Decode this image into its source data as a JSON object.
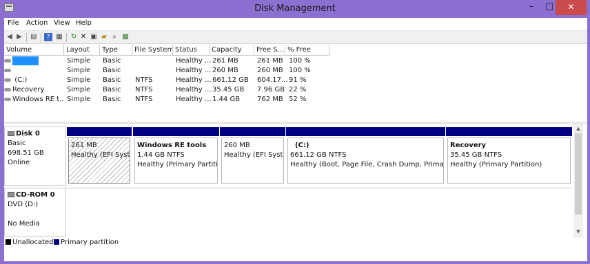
{
  "app": {
    "title": "Disk Management",
    "close_glyph": "✕",
    "minimize_glyph": "–",
    "maximize_glyph": "□"
  },
  "menu": [
    "File",
    "Action",
    "View",
    "Help"
  ],
  "toolbar_icons": [
    "back-arrow-icon",
    "forward-arrow-icon",
    "console-tree-icon",
    "help-icon",
    "details-icon",
    "refresh-icon",
    "delete-icon",
    "properties-icon",
    "open-icon",
    "find-icon",
    "wizard-icon"
  ],
  "table": {
    "columns": [
      "Volume",
      "Layout",
      "Type",
      "File System",
      "Status",
      "Capacity",
      "Free S...",
      "% Free"
    ],
    "rows": [
      {
        "volume": "",
        "layout": "Simple",
        "type": "Basic",
        "fs": "",
        "status": "Healthy ...",
        "capacity": "261 MB",
        "free": "261 MB",
        "pct": "100 %"
      },
      {
        "volume": "",
        "layout": "Simple",
        "type": "Basic",
        "fs": "",
        "status": "Healthy ...",
        "capacity": "260 MB",
        "free": "260 MB",
        "pct": "100 %"
      },
      {
        "volume": "(C:)",
        "layout": "Simple",
        "type": "Basic",
        "fs": "NTFS",
        "status": "Healthy ...",
        "capacity": "661.12 GB",
        "free": "604.17...",
        "pct": "91 %"
      },
      {
        "volume": "Recovery",
        "layout": "Simple",
        "type": "Basic",
        "fs": "NTFS",
        "status": "Healthy ...",
        "capacity": "35.45 GB",
        "free": "7.96 GB",
        "pct": "22 %"
      },
      {
        "volume": "Windows RE t...",
        "layout": "Simple",
        "type": "Basic",
        "fs": "NTFS",
        "status": "Healthy ...",
        "capacity": "1.44 GB",
        "free": "762 MB",
        "pct": "52 %"
      }
    ]
  },
  "disk0": {
    "name": "Disk 0",
    "kind": "Basic",
    "size": "698.51 GB",
    "state": "Online",
    "partitions": [
      {
        "name": "",
        "size": "261 MB",
        "status": "Healthy (EFI System"
      },
      {
        "name": "Windows RE tools",
        "size": "1.44 GB NTFS",
        "status": "Healthy (Primary Partition"
      },
      {
        "name": "",
        "size": "260 MB",
        "status": "Healthy (EFI System"
      },
      {
        "name": "(C:)",
        "size": "661.12 GB NTFS",
        "status": "Healthy (Boot, Page File, Crash Dump, Primary Pa"
      },
      {
        "name": "Recovery",
        "size": "35.45 GB NTFS",
        "status": "Healthy (Primary Partition)"
      }
    ]
  },
  "cdrom0": {
    "name": "CD-ROM 0",
    "kind": "DVD (D:)",
    "media": "No Media"
  },
  "legend": [
    {
      "label": "Unallocated",
      "color": "#000000"
    },
    {
      "label": "Primary partition",
      "color": "#000080"
    }
  ],
  "colors": {
    "titlebar": "#8b70d2",
    "partition_bar": "#000080",
    "selection": "#1e90ff"
  }
}
